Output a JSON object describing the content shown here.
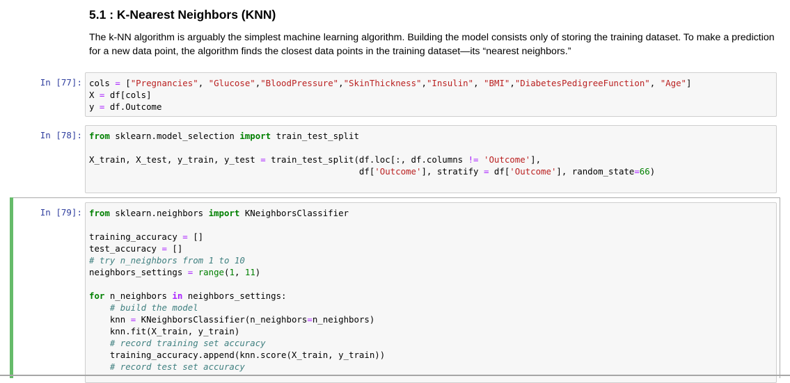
{
  "markdown": {
    "heading": "5.1 : K-Nearest Neighbors (KNN)",
    "paragraph": "The k-NN algorithm is arguably the simplest machine learning algorithm. Building the model consists only of storing the training dataset. To make a prediction for a new data point, the algorithm finds the closest data points in the training dataset—its “nearest neighbors.”"
  },
  "cells": [
    {
      "prompt": "In [77]:",
      "lines": [
        [
          [
            "cols ",
            ""
          ],
          [
            "=",
            "op"
          ],
          [
            " [",
            ""
          ],
          [
            "\"Pregnancies\"",
            "str"
          ],
          [
            ", ",
            ""
          ],
          [
            "\"Glucose\"",
            "str"
          ],
          [
            ",",
            ""
          ],
          [
            "\"BloodPressure\"",
            "str"
          ],
          [
            ",",
            ""
          ],
          [
            "\"SkinThickness\"",
            "str"
          ],
          [
            ",",
            ""
          ],
          [
            "\"Insulin\"",
            "str"
          ],
          [
            ", ",
            ""
          ],
          [
            "\"BMI\"",
            "str"
          ],
          [
            ",",
            ""
          ],
          [
            "\"DiabetesPedigreeFunction\"",
            "str"
          ],
          [
            ", ",
            ""
          ],
          [
            "\"Age\"",
            "str"
          ],
          [
            "]",
            ""
          ]
        ],
        [
          [
            "X ",
            ""
          ],
          [
            "=",
            "op"
          ],
          [
            " df[cols]",
            ""
          ]
        ],
        [
          [
            "y ",
            ""
          ],
          [
            "=",
            "op"
          ],
          [
            " df.Outcome",
            ""
          ]
        ]
      ]
    },
    {
      "prompt": "In [78]:",
      "lines": [
        [
          [
            "from",
            "kw"
          ],
          [
            " sklearn.model_selection ",
            ""
          ],
          [
            "import",
            "kw"
          ],
          [
            " train_test_split",
            ""
          ]
        ],
        [
          [
            "",
            ""
          ]
        ],
        [
          [
            "X_train, X_test, y_train, y_test ",
            ""
          ],
          [
            "=",
            "op"
          ],
          [
            " train_test_split(df.loc[:, df.columns ",
            ""
          ],
          [
            "!=",
            "op"
          ],
          [
            " ",
            ""
          ],
          [
            "'Outcome'",
            "str"
          ],
          [
            "],",
            ""
          ]
        ],
        [
          [
            "                                                    df[",
            ""
          ],
          [
            "'Outcome'",
            "str"
          ],
          [
            "], stratify ",
            ""
          ],
          [
            "=",
            "op"
          ],
          [
            " df[",
            ""
          ],
          [
            "'Outcome'",
            "str"
          ],
          [
            "], random_state",
            ""
          ],
          [
            "=",
            "op"
          ],
          [
            "66",
            "num"
          ],
          [
            ")",
            ""
          ]
        ],
        [
          [
            "",
            ""
          ]
        ]
      ]
    },
    {
      "prompt": "In [79]:",
      "lines": [
        [
          [
            "from",
            "kw"
          ],
          [
            " sklearn.neighbors ",
            ""
          ],
          [
            "import",
            "kw"
          ],
          [
            " KNeighborsClassifier",
            ""
          ]
        ],
        [
          [
            "",
            ""
          ]
        ],
        [
          [
            "training_accuracy ",
            ""
          ],
          [
            "=",
            "op"
          ],
          [
            " []",
            ""
          ]
        ],
        [
          [
            "test_accuracy ",
            ""
          ],
          [
            "=",
            "op"
          ],
          [
            " []",
            ""
          ]
        ],
        [
          [
            "# try n_neighbors from 1 to 10",
            "cmt"
          ]
        ],
        [
          [
            "neighbors_settings ",
            ""
          ],
          [
            "=",
            "op"
          ],
          [
            " ",
            ""
          ],
          [
            "range",
            "bi"
          ],
          [
            "(",
            ""
          ],
          [
            "1",
            "num"
          ],
          [
            ", ",
            ""
          ],
          [
            "11",
            "num"
          ],
          [
            ")",
            ""
          ]
        ],
        [
          [
            "",
            ""
          ]
        ],
        [
          [
            "for",
            "kw"
          ],
          [
            " n_neighbors ",
            ""
          ],
          [
            "in",
            "ow"
          ],
          [
            " neighbors_settings:",
            ""
          ]
        ],
        [
          [
            "    ",
            ""
          ],
          [
            "# build the model",
            "cmt"
          ]
        ],
        [
          [
            "    knn ",
            ""
          ],
          [
            "=",
            "op"
          ],
          [
            " KNeighborsClassifier(n_neighbors",
            ""
          ],
          [
            "=",
            "op"
          ],
          [
            "n_neighbors)",
            ""
          ]
        ],
        [
          [
            "    knn.fit(X_train, y_train)",
            ""
          ]
        ],
        [
          [
            "    ",
            ""
          ],
          [
            "# record training set accuracy",
            "cmt"
          ]
        ],
        [
          [
            "    training_accuracy.append(knn.score(X_train, y_train))",
            ""
          ]
        ],
        [
          [
            "    ",
            ""
          ],
          [
            "# record test set accuracy",
            "cmt"
          ]
        ]
      ]
    }
  ]
}
